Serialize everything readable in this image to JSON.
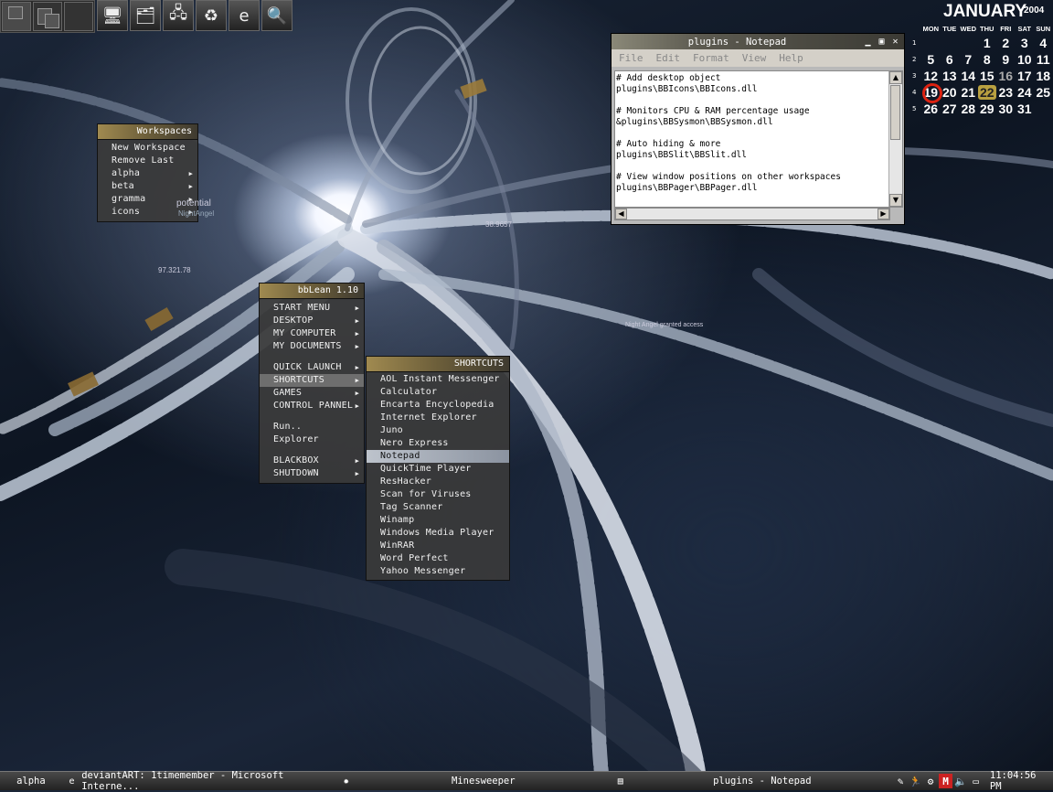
{
  "colors": {
    "menu_bg": "#3a3a3a",
    "title_gold": "#a08a50",
    "today_ring": "#dd2211",
    "holiday": "#b8a040"
  },
  "toolbar": {
    "icons": [
      {
        "name": "my-computer-icon",
        "glyph": "🖥"
      },
      {
        "name": "control-panel-icon",
        "glyph": "🗂"
      },
      {
        "name": "network-icon",
        "glyph": "🖧"
      },
      {
        "name": "recycle-bin-icon",
        "glyph": "♻"
      },
      {
        "name": "internet-explorer-icon",
        "glyph": "e"
      },
      {
        "name": "search-icon",
        "glyph": "🔍"
      }
    ]
  },
  "calendar": {
    "month": "JANUARY",
    "year": "2004",
    "dow": [
      "MON",
      "TUE",
      "WED",
      "THU",
      "FRI",
      "SAT",
      "SUN"
    ],
    "weeks": [
      {
        "wk": "1",
        "days": [
          "",
          "",
          "",
          "1",
          "2",
          "3",
          "4"
        ]
      },
      {
        "wk": "2",
        "days": [
          "5",
          "6",
          "7",
          "8",
          "9",
          "10",
          "11"
        ]
      },
      {
        "wk": "3",
        "days": [
          "12",
          "13",
          "14",
          "15",
          "16",
          "17",
          "18"
        ]
      },
      {
        "wk": "4",
        "days": [
          "19",
          "20",
          "21",
          "22",
          "23",
          "24",
          "25"
        ]
      },
      {
        "wk": "5",
        "days": [
          "26",
          "27",
          "28",
          "29",
          "30",
          "31",
          ""
        ]
      }
    ],
    "today": "19",
    "highlight": "22",
    "dim": "16"
  },
  "notepad": {
    "title": "plugins - Notepad",
    "menu": [
      "File",
      "Edit",
      "Format",
      "View",
      "Help"
    ],
    "text": "# Add desktop object\nplugins\\BBIcons\\BBIcons.dll\n\n# Monitors CPU & RAM percentage usage\n&plugins\\BBSysmon\\BBSysmon.dll\n\n# Auto hiding & more\nplugins\\BBSlit\\BBSlit.dll\n\n# View window positions on other workspaces\nplugins\\BBPager\\BBPager.dll"
  },
  "workspaces_menu": {
    "title": "Workspaces",
    "items": [
      {
        "label": "New Workspace",
        "sub": false
      },
      {
        "label": "Remove Last",
        "sub": false
      },
      {
        "label": "alpha",
        "sub": true
      },
      {
        "label": "beta",
        "sub": true
      },
      {
        "label": "gramma",
        "sub": true
      },
      {
        "label": "icons",
        "sub": true
      }
    ]
  },
  "main_menu": {
    "title": "bbLean 1.10",
    "groups": [
      [
        {
          "label": "START MENU",
          "sub": true
        },
        {
          "label": "DESKTOP",
          "sub": true
        },
        {
          "label": "MY COMPUTER",
          "sub": true
        },
        {
          "label": "MY DOCUMENTS",
          "sub": true
        }
      ],
      [
        {
          "label": "QUICK LAUNCH",
          "sub": true
        },
        {
          "label": "SHORTCUTS",
          "sub": true,
          "active": true
        },
        {
          "label": "GAMES",
          "sub": true
        },
        {
          "label": "CONTROL PANNEL",
          "sub": true
        }
      ],
      [
        {
          "label": "Run..",
          "sub": false
        },
        {
          "label": "Explorer",
          "sub": false
        }
      ],
      [
        {
          "label": "BLACKBOX",
          "sub": true
        },
        {
          "label": "SHUTDOWN",
          "sub": true
        }
      ]
    ]
  },
  "shortcuts_menu": {
    "title": "SHORTCUTS",
    "items": [
      "AOL Instant Messenger",
      "Calculator",
      "Encarta Encyclopedia",
      "Internet Explorer",
      "Juno",
      "Nero Express",
      "Notepad",
      "QuickTime Player",
      "ResHacker",
      "Scan for Viruses",
      "Tag Scanner",
      "Winamp",
      "Windows Media Player",
      "WinRAR",
      "Word Perfect",
      "Yahoo Messenger"
    ],
    "selected": "Notepad"
  },
  "desktop_text": {
    "potential": "potential",
    "nightangel": "NightAngel",
    "number1": "38.9657",
    "number2": "97.321.78",
    "access": "Night Angel granted access"
  },
  "taskbar": {
    "workspace": "alpha",
    "tasks": [
      {
        "label": "deviantART: 1timemember - Microsoft Interne...",
        "icon": "ie-icon"
      },
      {
        "label": "Minesweeper",
        "icon": "minesweeper-icon"
      },
      {
        "label": "plugins - Notepad",
        "icon": "notepad-icon"
      }
    ],
    "clock": "11:04:56 PM"
  }
}
